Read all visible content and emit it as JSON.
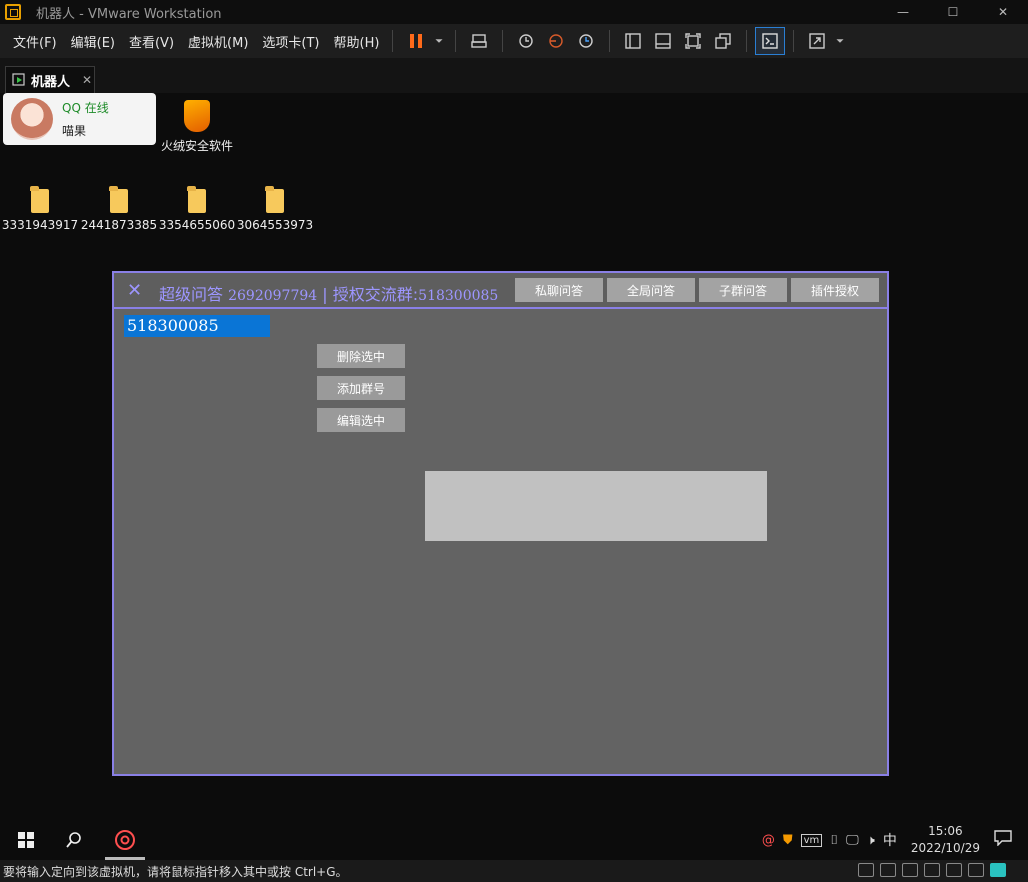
{
  "window": {
    "title": "机器人 - VMware Workstation",
    "minimize": "—",
    "maximize": "☐",
    "close": "✕"
  },
  "menu": [
    {
      "label": "文件(F)"
    },
    {
      "label": "编辑(E)"
    },
    {
      "label": "查看(V)"
    },
    {
      "label": "虚拟机(M)"
    },
    {
      "label": "选项卡(T)"
    },
    {
      "label": "帮助(H)"
    }
  ],
  "tab": {
    "label": "机器人",
    "close": "✕"
  },
  "qq_card": {
    "status": "QQ 在线",
    "name": "喵果"
  },
  "desktop_icons": {
    "huorong": "火绒安全软件",
    "folders": [
      "3331943917",
      "2441873385",
      "3354655060",
      "3064553973"
    ]
  },
  "plugin": {
    "close": "✕",
    "title_prefix": "超级问答",
    "bot_id": "2692097794",
    "separator": "|",
    "group_label": "授权交流群:",
    "group_id": "518300085",
    "tabs": [
      "私聊问答",
      "全局问答",
      "子群问答",
      "插件授权"
    ],
    "selected_group": "518300085",
    "buttons": {
      "delete": "删除选中",
      "add": "添加群号",
      "edit": "编辑选中"
    }
  },
  "taskbar": {
    "clock_time": "15:06",
    "clock_date": "2022/10/29",
    "ime": "中"
  },
  "statusbar": {
    "message": "要将输入定向到该虚拟机，请将鼠标指针移入其中或按 Ctrl+G。"
  },
  "colors": {
    "accent": "#8a80e6",
    "selection": "#0a75d6",
    "pause": "#ff6a1a"
  }
}
